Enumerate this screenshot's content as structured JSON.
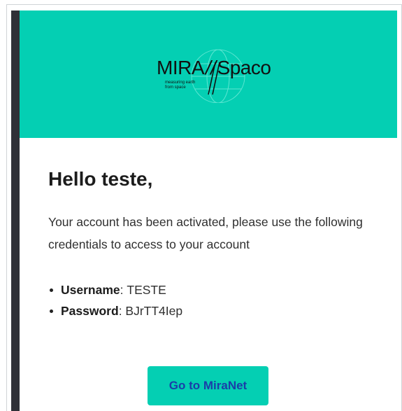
{
  "logo": {
    "brand": "MIRA",
    "brand_suffix": "Spaco",
    "separator": "//",
    "tagline": "measuring earth\nfrom space"
  },
  "email": {
    "greeting": "Hello teste,",
    "message": "Your account has been activated, please use the following credentials to access to your account",
    "credentials": [
      {
        "key": "Username",
        "value": "TESTE"
      },
      {
        "key": "Password",
        "value": "BJrTT4Iep"
      }
    ],
    "cta_label": "Go to MiraNet"
  },
  "colors": {
    "brand_teal": "#04cfb3",
    "link_blue": "#1a3ea8",
    "dark_frame": "#2f3037"
  }
}
